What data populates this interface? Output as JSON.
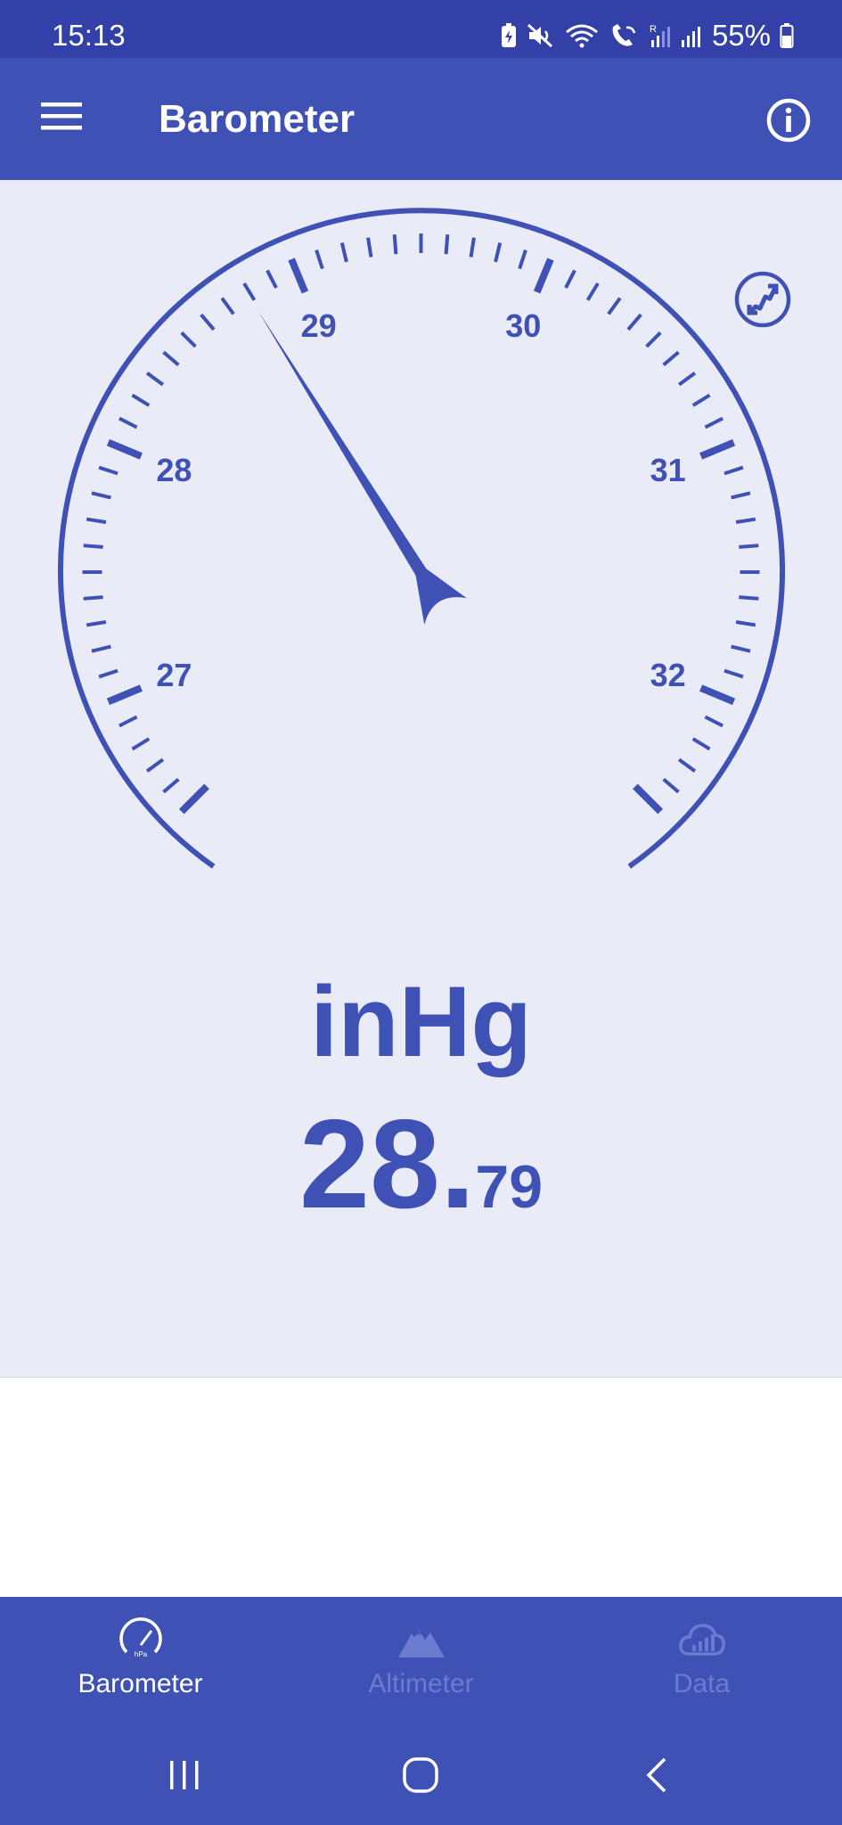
{
  "status_bar": {
    "time": "15:13",
    "battery": "55%",
    "icons": [
      "battery-saver-icon",
      "mute-icon",
      "wifi-icon",
      "wifi-calling-icon",
      "signal-roaming-icon",
      "signal-icon",
      "battery-icon"
    ]
  },
  "app_bar": {
    "title": "Barometer",
    "menu_icon": "menu-icon",
    "info_icon": "info-icon"
  },
  "gauge": {
    "scale_labels": [
      "27",
      "28",
      "29",
      "30",
      "31",
      "32"
    ],
    "min": 26.5,
    "max": 32.5,
    "value": 28.79,
    "calibrate_icon": "calibrate-icon"
  },
  "reading": {
    "unit": "inHg",
    "integer": "28",
    "separator": ".",
    "decimal": "79"
  },
  "bottom_nav": {
    "items": [
      {
        "label": "Barometer",
        "icon": "barometer-icon",
        "active": true
      },
      {
        "label": "Altimeter",
        "icon": "mountain-icon",
        "active": false
      },
      {
        "label": "Data",
        "icon": "cloud-chart-icon",
        "active": false
      }
    ]
  },
  "system_nav": [
    "recent-apps-icon",
    "home-icon",
    "back-icon"
  ],
  "colors": {
    "primary": "#3f51b5",
    "status_bar": "#3240a8",
    "panel": "#e9ebf6",
    "inactive": "#6b7bd0"
  }
}
